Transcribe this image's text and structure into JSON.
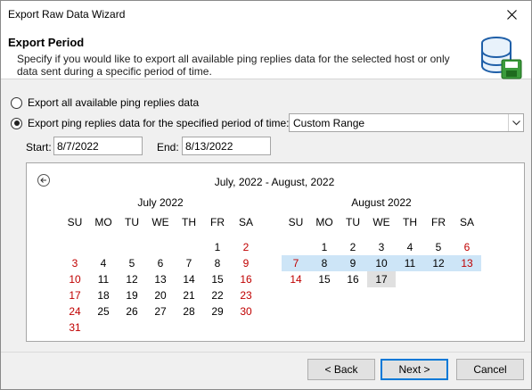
{
  "window": {
    "title": "Export Raw Data Wizard"
  },
  "header": {
    "title": "Export Period",
    "description": "Specify if you would like to export all available ping replies data for the selected host or only data sent during a specific period of time."
  },
  "options": {
    "all_label": "Export all available ping replies data",
    "period_label": "Export ping replies data for the specified period of time:",
    "selected": "period",
    "range_value": "Custom Range"
  },
  "dates": {
    "start_label": "Start:",
    "start_value": "8/7/2022",
    "end_label": "End:",
    "end_value": "8/13/2022"
  },
  "calendar": {
    "range_title": "July, 2022 - August, 2022",
    "weekdays": [
      "SU",
      "MO",
      "TU",
      "WE",
      "TH",
      "FR",
      "SA"
    ],
    "months": [
      {
        "title": "July 2022",
        "first_weekday": 5,
        "days": 31,
        "selected": [],
        "today": null
      },
      {
        "title": "August 2022",
        "first_weekday": 1,
        "days": 17,
        "selected": [
          7,
          8,
          9,
          10,
          11,
          12,
          13
        ],
        "today": 17
      }
    ]
  },
  "colors": {
    "weekend": "#c00000",
    "selection": "#cde5f7",
    "accent": "#0078d7"
  },
  "buttons": {
    "back": "< Back",
    "next": "Next >",
    "cancel": "Cancel"
  }
}
